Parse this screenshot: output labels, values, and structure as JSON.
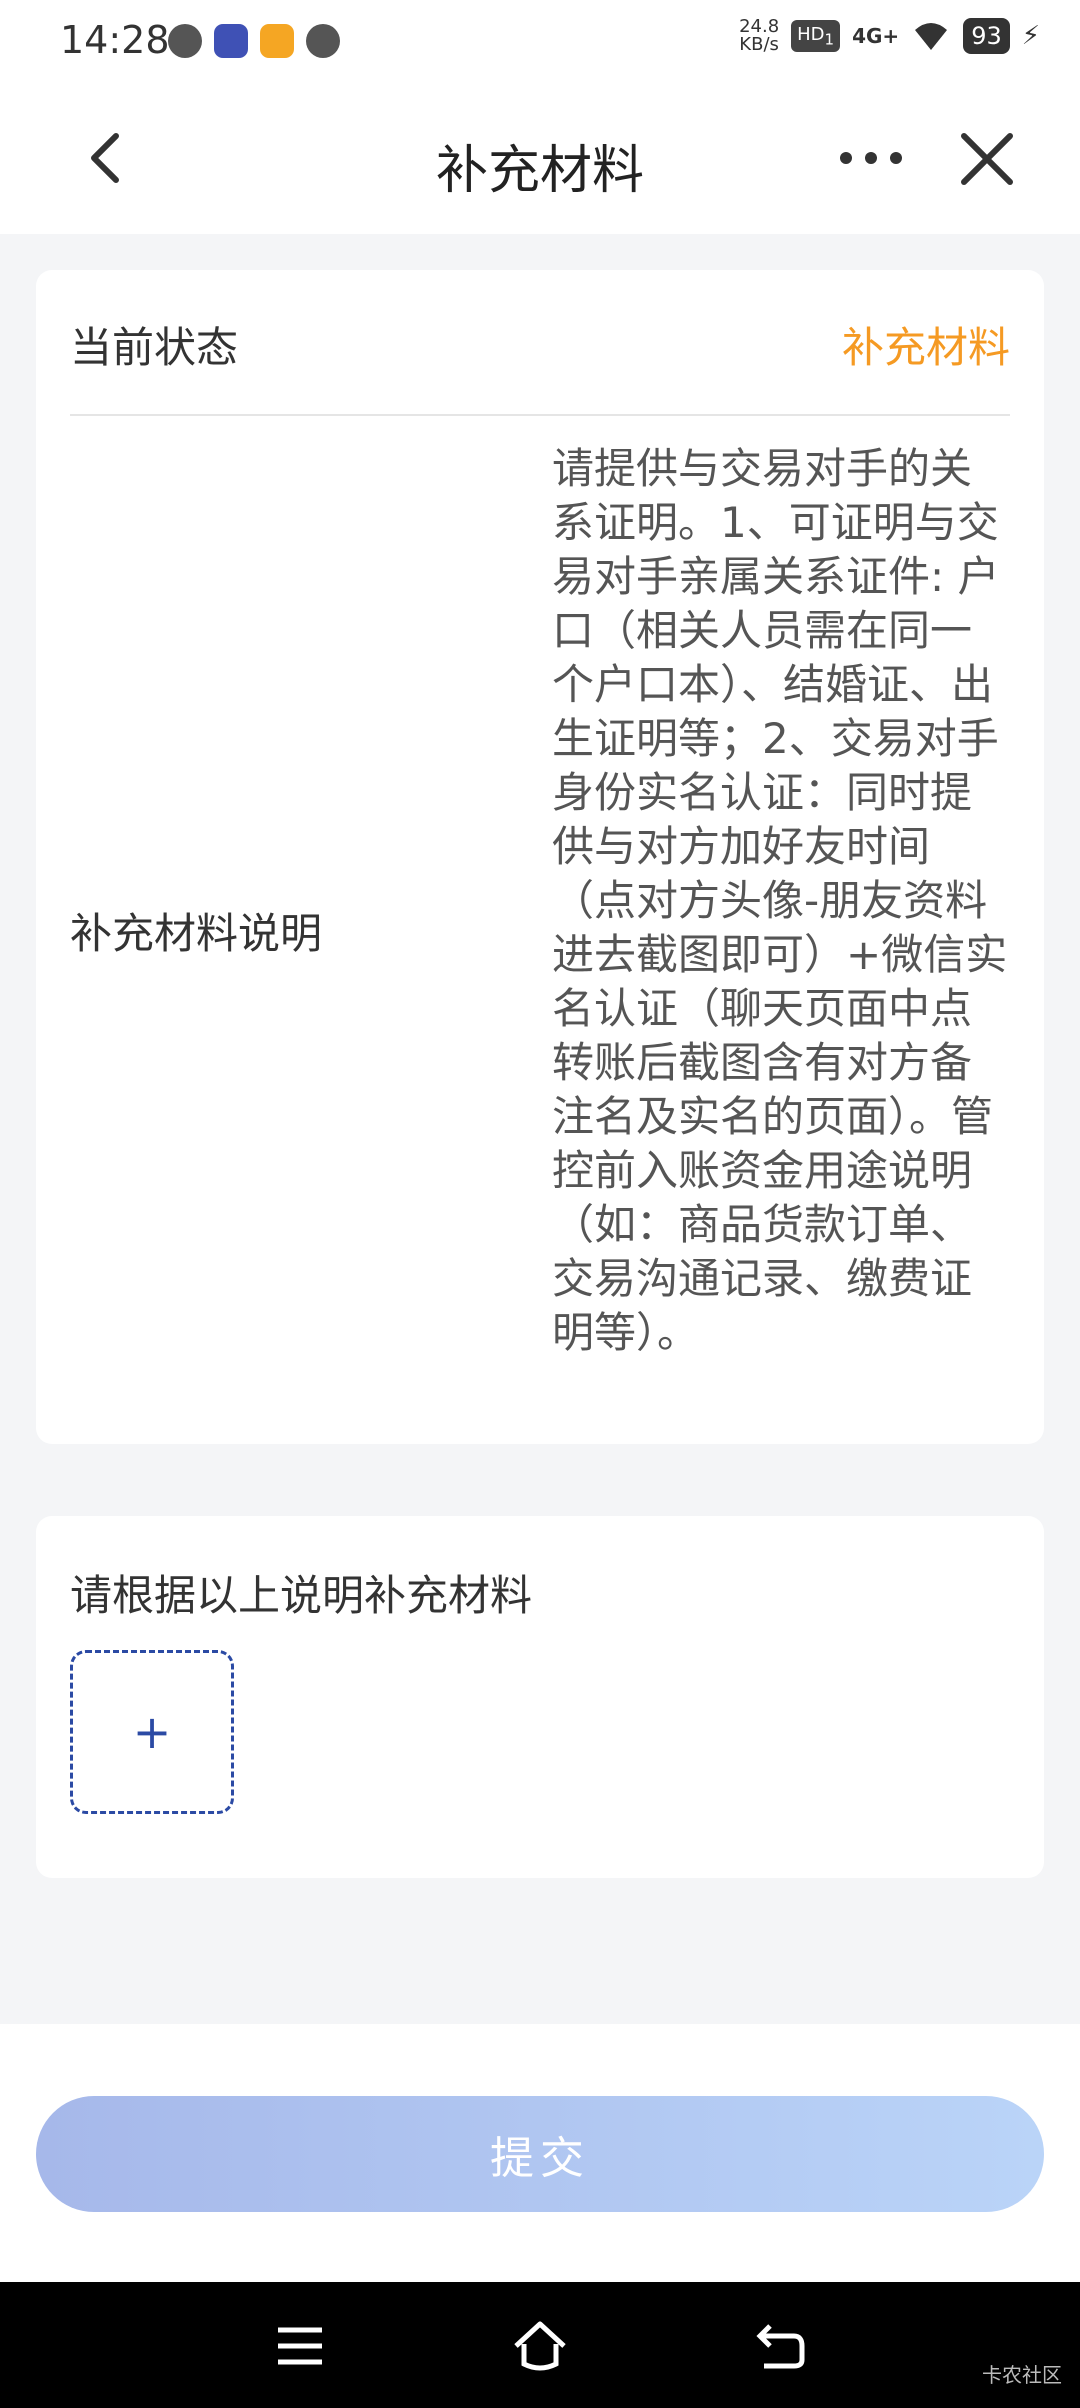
{
  "status_bar": {
    "time": "14:28",
    "speed": "24.8",
    "speed_unit": "KB/s",
    "hd": "HD",
    "hd_sub": "1",
    "network": "4G+",
    "battery": "93"
  },
  "nav": {
    "title": "补充材料"
  },
  "status_card": {
    "status_label": "当前状态",
    "status_value": "补充材料",
    "status_color": "#f59a23",
    "desc_label": "补充材料说明",
    "desc_text": "请提供与交易对手的关系证明。1、可证明与交易对手亲属关系证件: 户口（相关人员需在同一个户口本）、结婚证、出生证明等；2、交易对手身份实名认证：同时提供与对方加好友时间（点对方头像-朋友资料进去截图即可）+微信实名认证（聊天页面中点转账后截图含有对方备注名及实名的页面）。管控前入账资金用途说明（如：商品货款订单、交易沟通记录、缴费证明等）。"
  },
  "upload_card": {
    "title": "请根据以上说明补充材料",
    "add_symbol": "+"
  },
  "submit": {
    "label": "提交"
  },
  "watermark": "卡农社区",
  "icons": [
    "back-arrow-icon",
    "more-icon",
    "close-icon",
    "menu-icon",
    "home-icon",
    "back-icon",
    "wifi-icon",
    "signal-icon",
    "battery-icon"
  ]
}
